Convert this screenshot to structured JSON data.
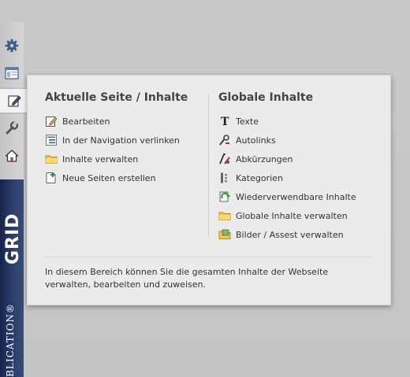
{
  "sidebar": {
    "buttons": [
      {
        "icon": "gear-icon"
      },
      {
        "icon": "layout-icon"
      },
      {
        "icon": "edit-icon"
      },
      {
        "icon": "wrench-icon"
      },
      {
        "icon": "home-icon"
      }
    ],
    "brand_grid": "GRID",
    "brand_web": "WEBLICATION®"
  },
  "panel": {
    "left": {
      "title": "Aktuelle Seite / Inhalte",
      "items": [
        {
          "label": "Bearbeiten",
          "icon": "edit-icon"
        },
        {
          "label": "In der Navigation verlinken",
          "icon": "navigation-link-icon"
        },
        {
          "label": "Inhalte verwalten",
          "icon": "folder-icon"
        },
        {
          "label": "Neue Seiten erstellen",
          "icon": "new-page-icon"
        }
      ]
    },
    "right": {
      "title": "Globale Inhalte",
      "items": [
        {
          "label": "Texte",
          "icon": "text-icon"
        },
        {
          "label": "Autolinks",
          "icon": "autolink-icon"
        },
        {
          "label": "Abkürzungen",
          "icon": "abbreviation-icon"
        },
        {
          "label": "Kategorien",
          "icon": "categories-icon"
        },
        {
          "label": "Wiederverwendbare Inhalte",
          "icon": "reusable-content-icon"
        },
        {
          "label": "Globale Inhalte verwalten",
          "icon": "folder-icon"
        },
        {
          "label": "Bilder / Assest verwalten",
          "icon": "image-folder-icon"
        }
      ]
    },
    "description": "In diesem Bereich können Sie die gesamten Inhalte der Webseite verwalten, bearbeiten und zuweisen."
  }
}
